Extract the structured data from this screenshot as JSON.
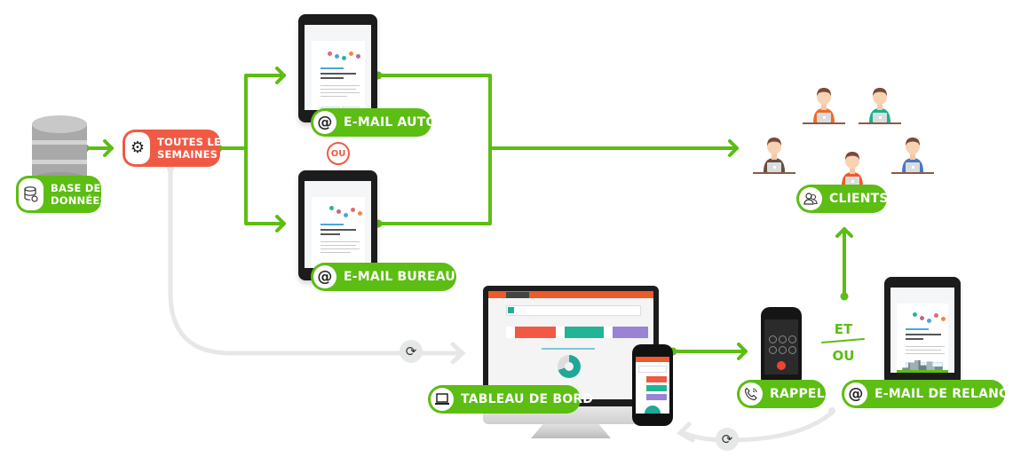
{
  "nodes": {
    "database": {
      "label_line1": "BASE DE",
      "label_line2": "DONNÉES",
      "icon": "database-icon"
    },
    "schedule": {
      "label_line1": "TOUTES LES",
      "label_line2": "SEMAINES",
      "icon": "gear-icon"
    },
    "email_auto": {
      "label": "E-MAIL AUTO",
      "icon": "at-icon"
    },
    "or_separator": {
      "label": "OU"
    },
    "email_bureaux": {
      "label": "E-MAIL BUREAUX",
      "icon": "at-icon"
    },
    "clients": {
      "label": "CLIENTS",
      "icon": "users-icon"
    },
    "dashboard": {
      "label": "TABLEAU DE BORD",
      "icon": "laptop-icon"
    },
    "rappel": {
      "label": "RAPPEL",
      "icon": "phone-icon"
    },
    "email_relance": {
      "label": "E-MAIL DE RELANCE",
      "icon": "at-icon"
    },
    "and_or": {
      "top": "ET",
      "bottom": "OU"
    }
  },
  "icons": {
    "at": "@",
    "gear": "⚙",
    "sync": "⟳",
    "phone": "✆"
  },
  "colors": {
    "green": "#5cbd12",
    "red": "#f05a45",
    "grey_flow": "#e6e7e7",
    "client_shirts": [
      "#ef6b2b",
      "#1cb08f",
      "#6b4d3c",
      "#f05a28",
      "#4a76c5"
    ]
  }
}
